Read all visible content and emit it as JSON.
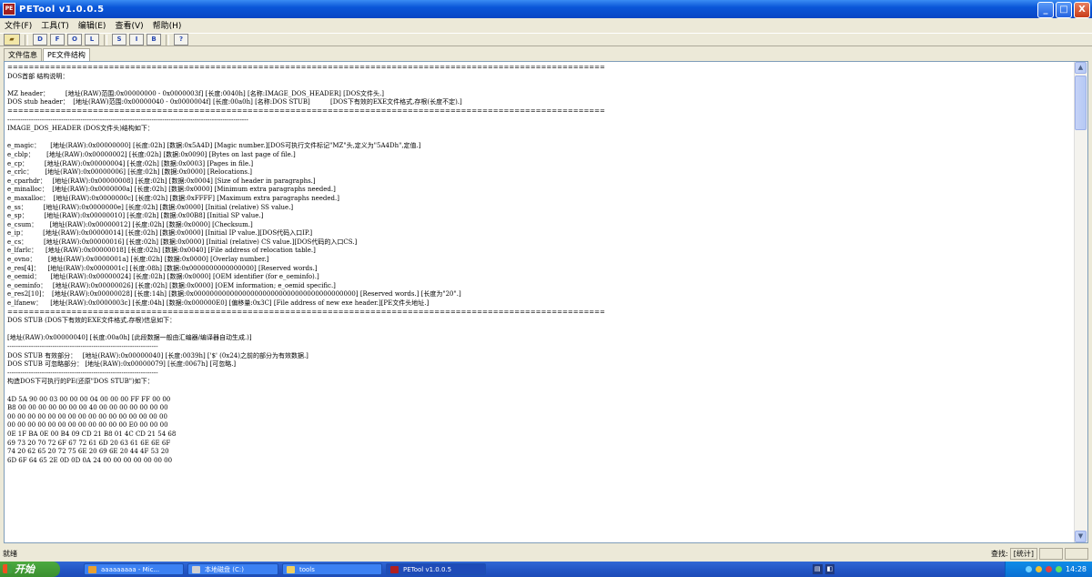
{
  "window": {
    "title": "PETool v1.0.0.5",
    "icon_label": "PE",
    "minimize": "_",
    "maximize": "□",
    "close": "X"
  },
  "menu": [
    "文件(F)",
    "工具(T)",
    "编辑(E)",
    "查看(V)",
    "帮助(H)"
  ],
  "toolbar": {
    "open_icon": "folder-open-icon",
    "buttons": [
      "D",
      "F",
      "O",
      "L",
      "S",
      "I",
      "B",
      "?"
    ]
  },
  "tabs": [
    {
      "label": "文件信息",
      "active": false
    },
    {
      "label": "PE文件结构",
      "active": true
    }
  ],
  "content_lines": [
    "================================================================================================================",
    "DOS首部 结构说明：",
    "",
    "MZ header：        [地址(RAW)范围:0x00000000 - 0x0000003f] [长度:0040h] [名称:IMAGE_DOS_HEADER] [DOS文件头.]",
    "DOS stub header：  [地址(RAW)范围:0x00000040 - 0x0000004f] [长度:00a0h] [名称:DOS STUB]          [DOS下有效的EXE文件格式,存根(长度不定).]",
    "================================================================================================================",
    "----------------------------------------------------------------------------------------------------------------",
    "IMAGE_DOS_HEADER (DOS文件头)结构如下：",
    "",
    "e_magic：     [地址(RAW):0x00000000] [长度:02h] [数据:0x5A4D] [Magic number.][DOS可执行文件标记\"MZ\"头,定义为\"5A4Dh\",定值.]",
    "e_cblp：      [地址(RAW):0x00000002] [长度:02h] [数据:0x0090] [Bytes on last page of file.]",
    "e_cp：        [地址(RAW):0x00000004] [长度:02h] [数据:0x0003] [Pages in file.]",
    "e_crlc：      [地址(RAW):0x00000006] [长度:02h] [数据:0x0000] [Relocations.]",
    "e_cparhdr：   [地址(RAW):0x00000008] [长度:02h] [数据:0x0004] [Size of header in paragraphs.]",
    "e_minalloc：  [地址(RAW):0x0000000a] [长度:02h] [数据:0x0000] [Minimum extra paragraphs needed.]",
    "e_maxalloc：  [地址(RAW):0x0000000c] [长度:02h] [数据:0xFFFF] [Maximum extra paragraphs needed.]",
    "e_ss：        [地址(RAW):0x0000000e] [长度:02h] [数据:0x0000] [Initial (relative) SS value.]",
    "e_sp：        [地址(RAW):0x00000010] [长度:02h] [数据:0x00B8] [Initial SP value.]",
    "e_csum：      [地址(RAW):0x00000012] [长度:02h] [数据:0x0000] [Checksum.]",
    "e_ip：        [地址(RAW):0x00000014] [长度:02h] [数据:0x0000] [Initial IP value.][DOS代码入口IP.]",
    "e_cs：        [地址(RAW):0x00000016] [长度:02h] [数据:0x0000] [Initial (relative) CS value.][DOS代码的入口CS.]",
    "e_lfarlc：    [地址(RAW):0x00000018] [长度:02h] [数据:0x0040] [File address of relocation table.]",
    "e_ovno：      [地址(RAW):0x0000001a] [长度:02h] [数据:0x0000] [Overlay number.]",
    "e_res[4]：    [地址(RAW):0x0000001c] [长度:08h] [数据:0x0000000000000000] [Reserved words.]",
    "e_oemid：     [地址(RAW):0x00000024] [长度:02h] [数据:0x0000] [OEM identifier (for e_oeminfo).]",
    "e_oeminfo：   [地址(RAW):0x00000026] [长度:02h] [数据:0x0000] [OEM information; e_oemid specific.]",
    "e_res2[10]：  [地址(RAW):0x00000028] [长度:14h] [数据:0x0000000000000000000000000000000000000000] [Reserved words.] [长度为\"20\".]",
    "e_lfanew：    [地址(RAW):0x0000003c] [长度:04h] [数据:0x000000E0] [偏移量:0x3C] [File address of new exe header.][PE文件头地址.]",
    "================================================================================================================",
    "DOS STUB (DOS下有效的EXE文件格式,存根)信息如下：",
    "",
    "[地址(RAW):0x00000040] [长度:00a0h] [此段数据一般由汇编器/编译器自动生成.)]",
    "----------------------------------------------------------------------",
    "DOS STUB 有效部分：   [地址(RAW):0x00000040] [长度:0039h] ['$' (0x24)之前的部分为有效数据.]",
    "DOS STUB 可忽略部分： [地址(RAW):0x00000079] [长度:0067h] [可忽略.]",
    "----------------------------------------------------------------------",
    "构造DOS下可执行的PE(还原\"DOS STUB\")如下：",
    "",
    "4D 5A 90 00 03 00 00 00 04 00 00 00 FF FF 00 00",
    "B8 00 00 00 00 00 00 00 40 00 00 00 00 00 00 00",
    "00 00 00 00 00 00 00 00 00 00 00 00 00 00 00 00",
    "00 00 00 00 00 00 00 00 00 00 00 00 E0 00 00 00",
    "0E 1F BA 0E 00 B4 09 CD 21 B8 01 4C CD 21 54 68",
    "69 73 20 70 72 6F 67 72 61 6D 20 63 61 6E 6E 6F",
    "74 20 62 65 20 72 75 6E 20 69 6E 20 44 4F 53 20",
    "6D 6F 64 65 2E 0D 0D 0A 24 00 00 00 00 00 00 00"
  ],
  "status": {
    "left": "就绪",
    "find_label": "查找:",
    "stats": "[统计]"
  },
  "taskbar": {
    "start": "开始",
    "items": [
      {
        "label": "aaaaaaaaa - Mic...",
        "active": false,
        "icon_color": "#e8a030"
      },
      {
        "label": "本地磁盘 (C:)",
        "active": false,
        "icon_color": "#d0d0d0"
      },
      {
        "label": "tools",
        "active": false,
        "icon_color": "#f0d060"
      },
      {
        "label": "PETool v1.0.0.5",
        "active": true,
        "icon_color": "#b02020"
      }
    ],
    "clock": "14:28"
  }
}
